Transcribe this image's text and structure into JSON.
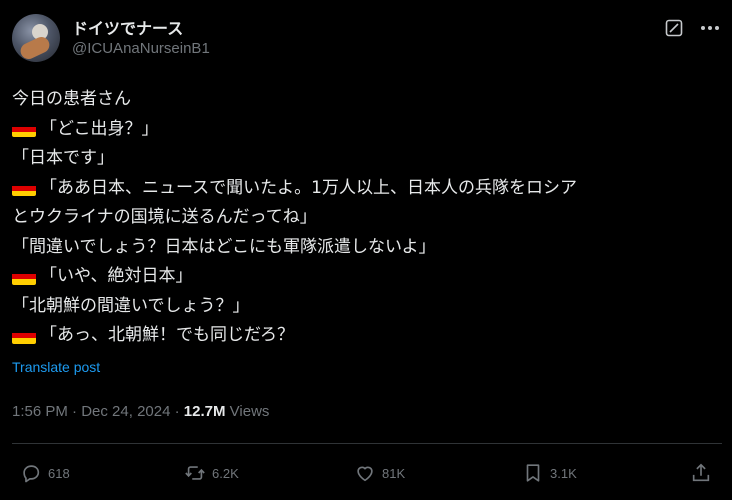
{
  "user": {
    "display_name": "ドイツでナース",
    "handle": "@ICUAnaNurseinB1"
  },
  "tweet": {
    "lines": [
      {
        "flag": false,
        "text": "今日の患者さん"
      },
      {
        "flag": true,
        "text": "「どこ出身？」"
      },
      {
        "flag": false,
        "text": "「日本です」"
      },
      {
        "flag": true,
        "text": "「ああ日本、ニュースで聞いたよ。1万人以上、日本人の兵隊をロシア"
      },
      {
        "flag": false,
        "text": "とウクライナの国境に送るんだってね」"
      },
      {
        "flag": false,
        "text": "「間違いでしょう？日本はどこにも軍隊派遣しないよ」"
      },
      {
        "flag": true,
        "text": "「いや、絶対日本」"
      },
      {
        "flag": false,
        "text": "「北朝鮮の間違いでしょう？」"
      },
      {
        "flag": true,
        "text": "「あっ、北朝鮮！でも同じだろ？"
      }
    ],
    "flag_icon": "germany-flag-emoji",
    "flag_colors": [
      "#000000",
      "#dd0000",
      "#ffce00"
    ]
  },
  "translate_label": "Translate post",
  "meta": {
    "time": "1:56 PM",
    "separator": "·",
    "date": "Dec 24, 2024",
    "views_count": "12.7M",
    "views_label": "Views"
  },
  "actions": {
    "replies": "618",
    "reposts": "6.2K",
    "likes": "81K",
    "bookmarks": "3.1K"
  },
  "colors": {
    "background": "#000000",
    "text": "#e7e9ea",
    "muted": "#71767b",
    "link": "#1d9bf0",
    "divider": "#2f3336"
  }
}
